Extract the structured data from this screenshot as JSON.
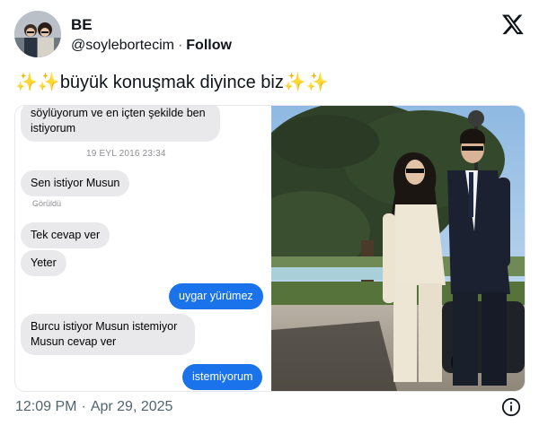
{
  "author": {
    "name": "BE",
    "handle": "@soylebortecim",
    "separator": "·",
    "follow_label": "Follow"
  },
  "tweet": {
    "sparkles_left": "✨✨",
    "text": "büyük konuşmak diyince biz",
    "sparkles_right": "✨✨"
  },
  "chat": {
    "messages": [
      {
        "side": "in",
        "text_line1": "söylüyorum ve en içten şekilde ben",
        "text_line2": "istiyorum"
      },
      {
        "type": "timestamp",
        "text": "19 EYL 2016 23:34"
      },
      {
        "side": "in",
        "text": "Sen istiyor Musun"
      },
      {
        "type": "seen",
        "text": "Görüldü"
      },
      {
        "side": "in",
        "text": "Tek cevap ver"
      },
      {
        "side": "in",
        "text": "Yeter"
      },
      {
        "side": "out",
        "text": "uygar yürümez"
      },
      {
        "side": "in",
        "text_line1": "Burcu istiyor Musun istemiyor",
        "text_line2": "Musun cevap ver"
      },
      {
        "side": "out",
        "text": "istemiyorum"
      }
    ]
  },
  "footer": {
    "time": "12:09 PM",
    "separator": "·",
    "date": "Apr 29, 2025"
  },
  "icons": {
    "brand": "x-logo-icon",
    "info": "info-icon"
  },
  "colors": {
    "text": "#0f1419",
    "secondary": "#536471",
    "bubble_in": "#e9e9eb",
    "bubble_out": "#1a73ea"
  }
}
